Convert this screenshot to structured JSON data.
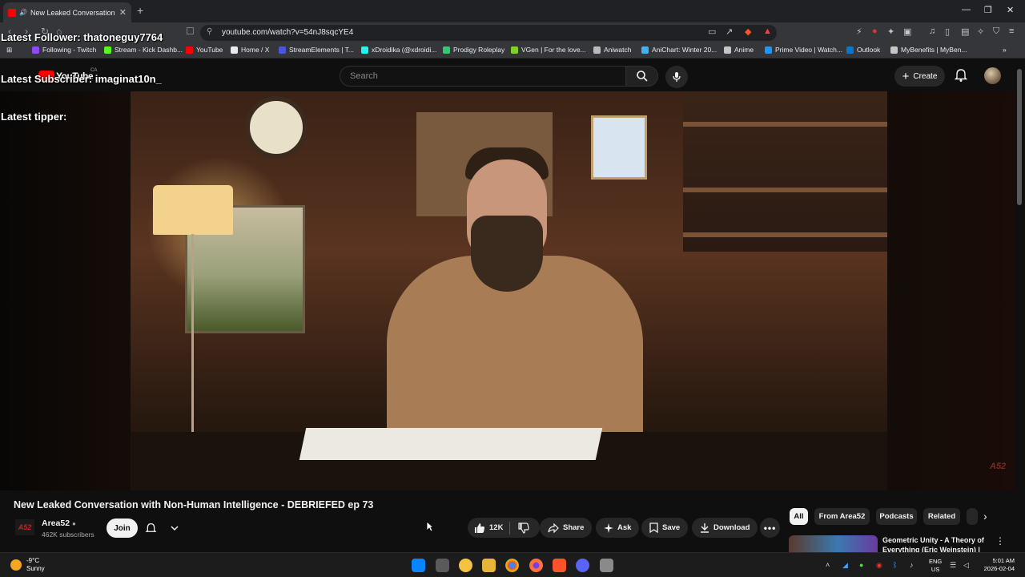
{
  "browser": {
    "tab_title": "New Leaked Conversation wi",
    "url": "youtube.com/watch?v=54nJ8sqcYE4",
    "bookmarks": [
      {
        "label": "Following - Twitch",
        "color": "#9146ff"
      },
      {
        "label": "Stream - Kick Dashb...",
        "color": "#53fc18"
      },
      {
        "label": "YouTube",
        "color": "#ff0000"
      },
      {
        "label": "Home / X",
        "color": "#e8eaed"
      },
      {
        "label": "StreamElements | T...",
        "color": "#4a56e2"
      },
      {
        "label": "xDroidika (@xdroidi...",
        "color": "#25f4ee"
      },
      {
        "label": "Prodigy Roleplay",
        "color": "#2ecc71"
      },
      {
        "label": "VGen | For the love...",
        "color": "#7ed321"
      },
      {
        "label": "Aniwatch",
        "color": "#bbbbbb"
      },
      {
        "label": "AniChart: Winter 20...",
        "color": "#3db4f2"
      },
      {
        "label": "Anime",
        "color": "#c4c7c5"
      },
      {
        "label": "Prime Video | Watch...",
        "color": "#1a98ff"
      },
      {
        "label": "Outlook",
        "color": "#0078d4"
      },
      {
        "label": "MyBenefits | MyBen...",
        "color": "#c4c7c5"
      }
    ]
  },
  "youtube": {
    "logo_text": "YouTube",
    "country": "CA",
    "search_placeholder": "Search",
    "create_label": "Create"
  },
  "overlay": {
    "follower": "Latest Follower: thatoneguy7764",
    "subscriber": "Latest Subscriber: imaginat10n_",
    "tipper": "Latest tipper:"
  },
  "video": {
    "title": "New Leaked Conversation with Non-Human Intelligence - DEBRIEFED ep 73",
    "watermark": "A52",
    "channel": {
      "avatar_text": "A52",
      "name": "Area52",
      "subscribers": "462K subscribers"
    },
    "join_label": "Join",
    "likes": "12K",
    "actions": {
      "share": "Share",
      "ask": "Ask",
      "save": "Save",
      "download": "Download"
    }
  },
  "sidebar": {
    "chips": [
      "All",
      "From Area52",
      "Podcasts",
      "Related"
    ],
    "recommended": [
      {
        "title": "Geometric Unity - A Theory of Everything (Eric Weinstein) | AI..."
      }
    ]
  },
  "taskbar": {
    "temperature": "-9°C",
    "weather": "Sunny",
    "lang_top": "ENG",
    "lang_bottom": "US",
    "time": "5:01 AM",
    "date": "2026-02-04"
  }
}
